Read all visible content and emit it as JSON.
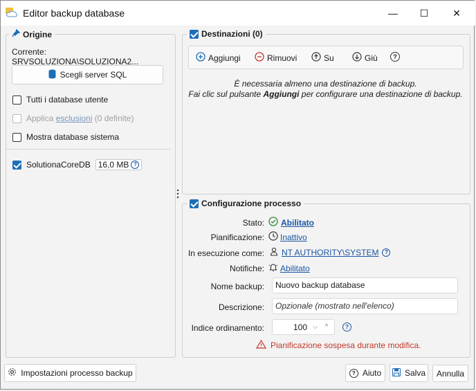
{
  "window": {
    "title": "Editor backup database",
    "minimize": "—",
    "maximize": "☐",
    "close": "✕"
  },
  "origin": {
    "legend": "Origine",
    "current": "Corrente: SRVSOLUZIONA\\SOLUZIONA2...",
    "choose_server": "Scegli server SQL",
    "all_user_db": "Tutti i database utente",
    "apply_prefix": "Applica ",
    "exclusions": "esclusioni",
    "defined": " (0 definite)",
    "show_system": "Mostra database sistema",
    "database": {
      "name": "SolutionaCoreDB",
      "size": "16,0 MB"
    }
  },
  "destinations": {
    "legend": "Destinazioni (0)",
    "toolbar": {
      "add": "Aggiungi",
      "remove": "Rimuovi",
      "up": "Su",
      "down": "Giù",
      "help": "?"
    },
    "msg_line1": "È necessaria almeno una destinazione di backup.",
    "msg_line2_a": "Fai clic sul pulsante ",
    "msg_line2_b": "Aggiungi",
    "msg_line2_c": " per configurare una destinazione di backup."
  },
  "process": {
    "legend": "Configurazione processo",
    "state_label": "Stato:",
    "state_value": "Abilitato",
    "schedule_label": "Pianificazione:",
    "schedule_value": "Inattivo",
    "run_as_label": "In esecuzione come:",
    "run_as_value": "NT AUTHORITY\\SYSTEM",
    "notifications_label": "Notifiche:",
    "notifications_value": "Abilitato",
    "name_label": "Nome backup:",
    "name_value": "Nuovo backup database",
    "desc_label": "Descrizione:",
    "desc_placeholder": "Opzionale (mostrato nell'elenco)",
    "order_label": "Indice ordinamento:",
    "order_value": "100",
    "warning": "Pianificazione sospesa durante modifica."
  },
  "footer": {
    "settings": "Impostazioni processo backup",
    "help": "Aiuto",
    "save": "Salva",
    "cancel": "Annulla"
  },
  "colors": {
    "accent": "#1d6fb8",
    "link": "#1a55a3",
    "warning": "#c0392b"
  }
}
